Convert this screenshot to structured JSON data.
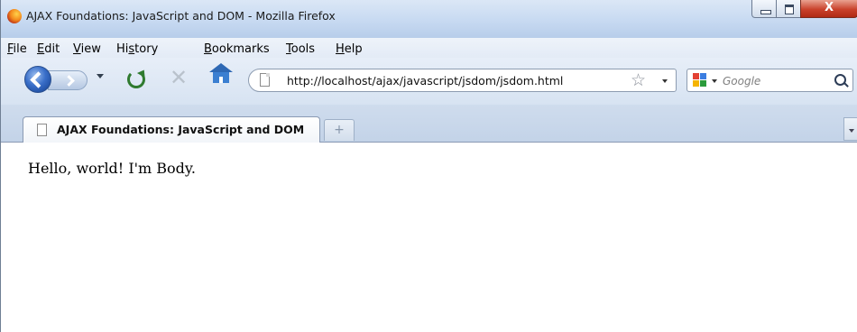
{
  "window": {
    "title": "AJAX Foundations: JavaScript and DOM - Mozilla Firefox",
    "close_glyph": "X"
  },
  "menu": [
    {
      "label": "File",
      "access_key": "F",
      "rest": "ile"
    },
    {
      "label": "Edit",
      "access_key": "E",
      "rest": "dit"
    },
    {
      "label": "View",
      "access_key": "V",
      "rest": "iew"
    },
    {
      "label": "History",
      "pre": "Hi",
      "access_key": "s",
      "rest": "tory"
    },
    {
      "label": "Bookmarks",
      "access_key": "B",
      "rest": "ookmarks"
    },
    {
      "label": "Tools",
      "access_key": "T",
      "rest": "ools"
    },
    {
      "label": "Help",
      "access_key": "H",
      "rest": "elp"
    }
  ],
  "navbar": {
    "url": "http://localhost/ajax/javascript/jsdom/jsdom.html",
    "search_placeholder": "Google",
    "icons": [
      "back-arrow-icon",
      "forward-arrow-icon",
      "reload-icon",
      "stop-icon",
      "home-icon",
      "page-icon",
      "star-icon",
      "google-icon",
      "magnifier-icon"
    ]
  },
  "tabs": [
    {
      "label": "AJAX Foundations: JavaScript and DOM",
      "active": true
    }
  ],
  "new_tab_glyph": "+",
  "content": {
    "text": "Hello, world! I'm Body."
  },
  "colors": {
    "titlebar": "#c9dbf2",
    "close_button": "#c9412b",
    "reload": "#2f7a2f",
    "home": "#3b7fd1"
  }
}
